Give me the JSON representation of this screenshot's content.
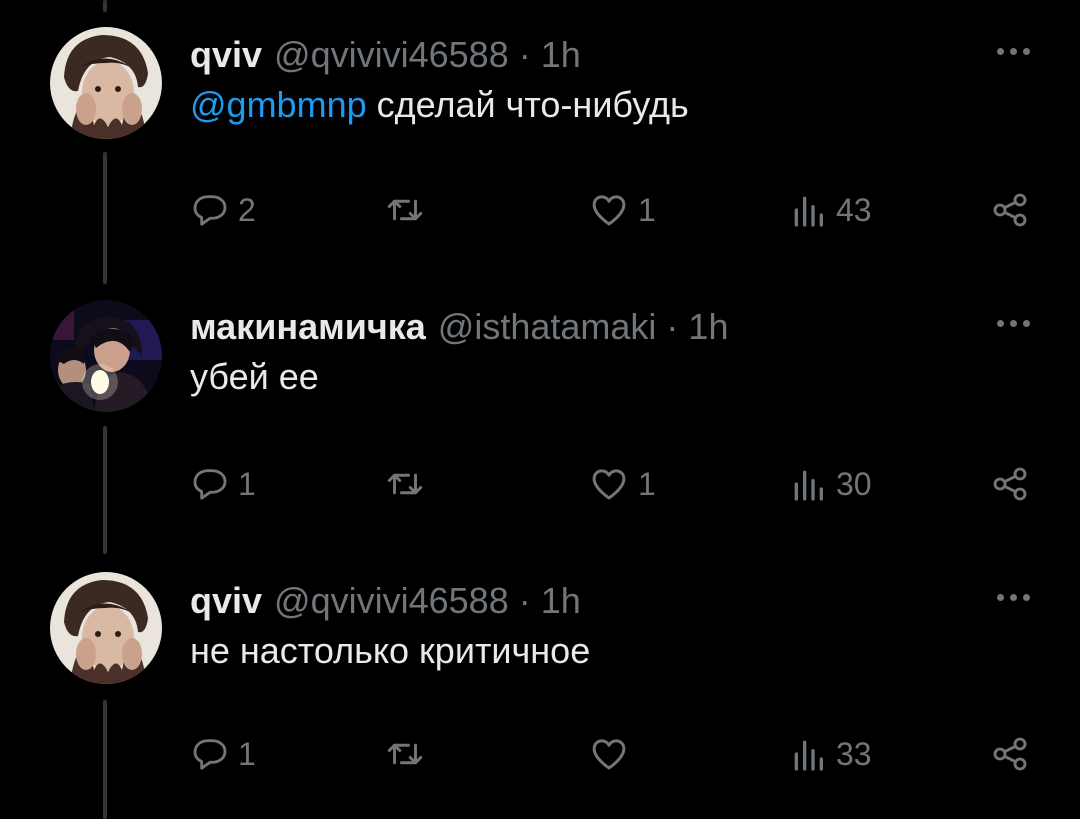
{
  "tweets": [
    {
      "display_name": "qviv",
      "handle": "@qvivivi46588",
      "separator": "·",
      "time": "1h",
      "mention": "@gmbmnp",
      "text": " сделай что-нибудь",
      "replies": "2",
      "retweets": "",
      "likes": "1",
      "views": "43"
    },
    {
      "display_name": "макинамичка",
      "handle": "@isthatamaki",
      "separator": "·",
      "time": "1h",
      "text": "убей ее",
      "replies": "1",
      "retweets": "",
      "likes": "1",
      "views": "30"
    },
    {
      "display_name": "qviv",
      "handle": "@qvivivi46588",
      "separator": "·",
      "time": "1h",
      "text": "не настолько критичное",
      "replies": "1",
      "retweets": "",
      "likes": "",
      "views": "33"
    }
  ],
  "icons": {
    "reply": "reply-icon",
    "retweet": "retweet-icon",
    "like": "heart-icon",
    "views": "views-icon",
    "share": "share-icon",
    "more": "more-icon"
  },
  "colors": {
    "background": "#000000",
    "text": "#e7e9ea",
    "secondary": "#71767b",
    "mention": "#1d9bf0",
    "thread_line": "#333639"
  }
}
